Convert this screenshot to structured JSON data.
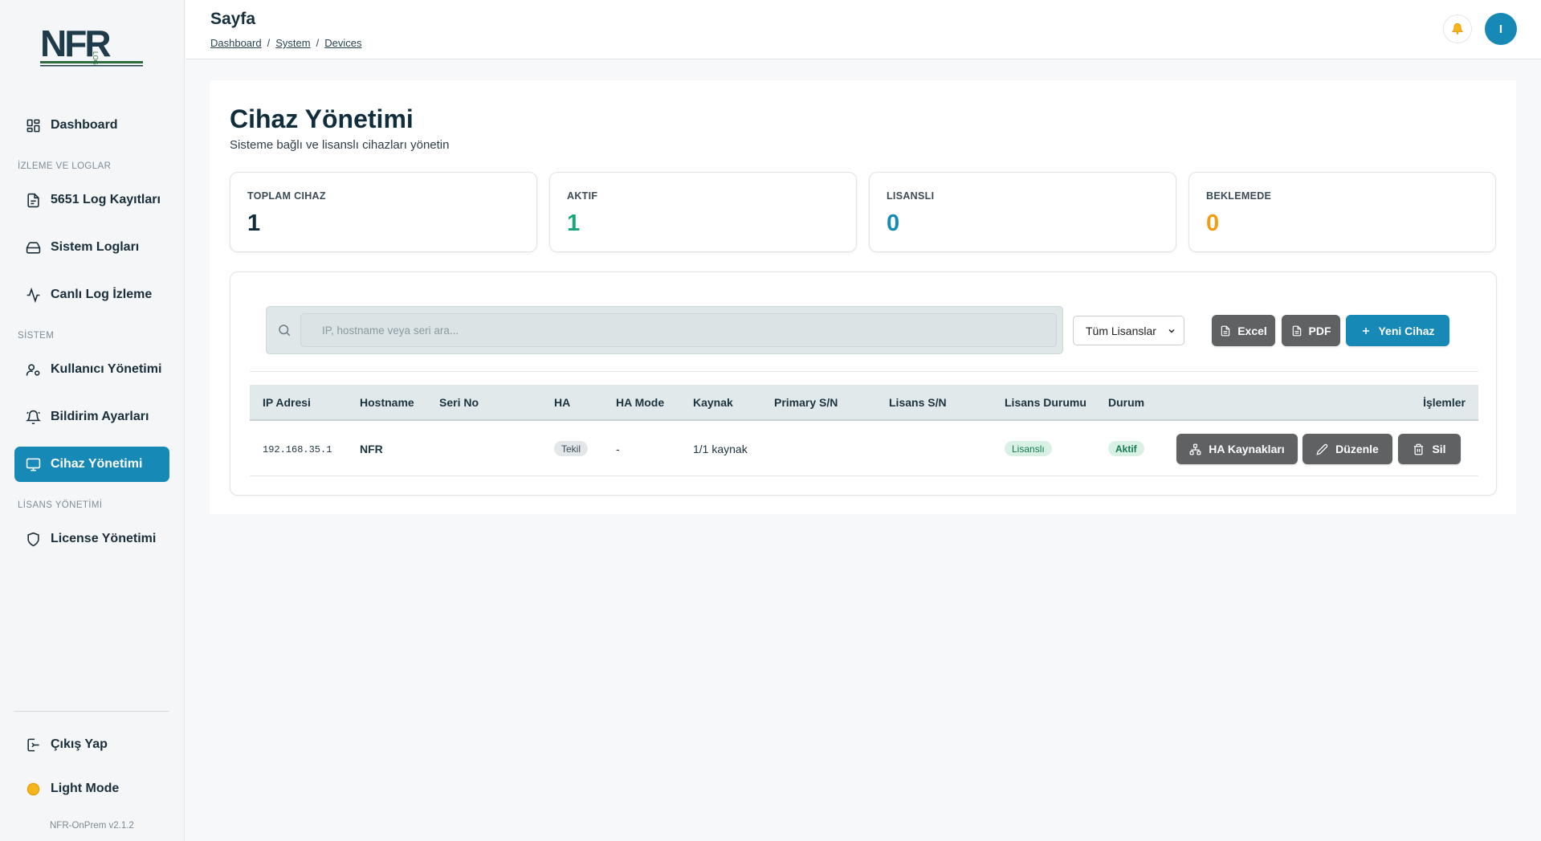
{
  "sidebar": {
    "logo_text": "NFR Log",
    "items": [
      {
        "label": "Dashboard",
        "icon": "dashboard-icon"
      },
      {
        "label": "5651 Log Kayıtları",
        "icon": "log-file-icon"
      },
      {
        "label": "Sistem Logları",
        "icon": "hard-drive-icon"
      },
      {
        "label": "Canlı Log İzleme",
        "icon": "activity-icon"
      },
      {
        "label": "Kullanıcı Yönetimi",
        "icon": "user-settings-icon"
      },
      {
        "label": "Bildirim Ayarları",
        "icon": "bell-icon"
      },
      {
        "label": "Cihaz Yönetimi",
        "icon": "monitor-icon",
        "active": true
      },
      {
        "label": "License Yönetimi",
        "icon": "shield-icon"
      }
    ],
    "sections": [
      "İZLEME VE LOGLAR",
      "SİSTEM",
      "LİSANS YÖNETİMİ"
    ],
    "logout_label": "Çıkış Yap",
    "theme_label": "Light Mode",
    "version": "NFR-OnPrem v2.1.2"
  },
  "header": {
    "page_label": "Sayfa",
    "breadcrumb": [
      "Dashboard",
      "System",
      "Devices"
    ],
    "user_initial": "I"
  },
  "main": {
    "title": "Cihaz Yönetimi",
    "subtitle": "Sisteme bağlı ve lisanslı cihazları yönetin",
    "stats": [
      {
        "label": "TOPLAM CIHAZ",
        "value": "1",
        "color": "#0f2d3d"
      },
      {
        "label": "AKTIF",
        "value": "1",
        "color": "#1aa67a"
      },
      {
        "label": "LISANSLI",
        "value": "0",
        "color": "#1689b6"
      },
      {
        "label": "BEKLEMEDE",
        "value": "0",
        "color": "#f39c12"
      }
    ],
    "search": {
      "placeholder": "IP, hostname veya seri ara..."
    },
    "license_filter": {
      "selected": "Tüm Lisanslar"
    },
    "buttons": {
      "excel": "Excel",
      "pdf": "PDF",
      "new_device": "Yeni Cihaz"
    },
    "table": {
      "columns": [
        "IP Adresi",
        "Hostname",
        "Seri No",
        "HA",
        "HA Mode",
        "Kaynak",
        "Primary S/N",
        "Lisans S/N",
        "Lisans Durumu",
        "Durum",
        "İşlemler"
      ],
      "rows": [
        {
          "ip": "192.168.35.1",
          "hostname": "NFR",
          "serial": "",
          "ha": "Tekil",
          "ha_mode": "-",
          "source": "1/1 kaynak",
          "primary_sn": "",
          "license_sn": "",
          "license_status": "Lisanslı",
          "status": "Aktif",
          "actions": {
            "ha_sources": "HA Kaynakları",
            "edit": "Düzenle",
            "delete": "Sil"
          }
        }
      ]
    }
  },
  "colors": {
    "accent": "#1689b6",
    "gray_button": "#5f6163",
    "logo_green": "#2e6b3a"
  }
}
